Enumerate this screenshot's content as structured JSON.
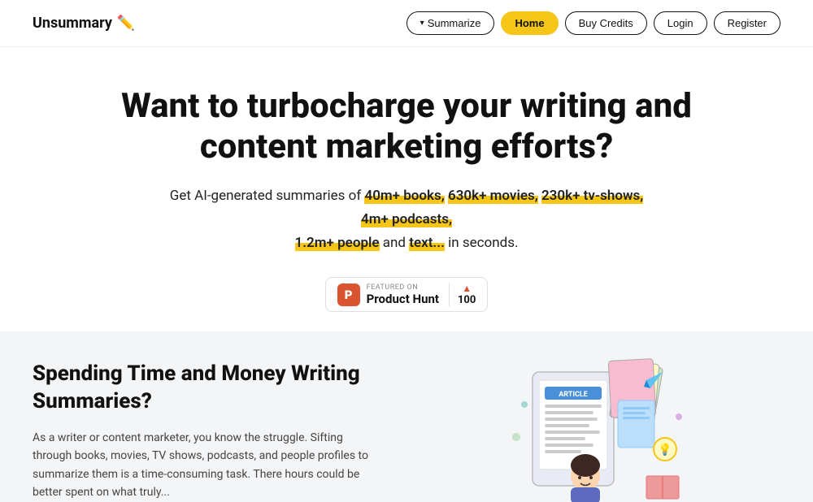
{
  "logo": {
    "text": "Unsummary",
    "icon": "✏️"
  },
  "nav": {
    "summarize_label": "Summarize",
    "home_label": "Home",
    "buy_credits_label": "Buy Credits",
    "login_label": "Login",
    "register_label": "Register"
  },
  "hero": {
    "title": "Want to turbocharge your writing and content marketing efforts?",
    "subtitle_before": "Get AI-generated summaries of ",
    "highlights": [
      "40m+ books,",
      "630k+ movies,",
      "230k+ tv-shows,",
      "4m+ podcasts,",
      "1.2m+ people"
    ],
    "subtitle_and": " and ",
    "subtitle_text": "text...",
    "subtitle_end": " in seconds."
  },
  "product_hunt": {
    "featured_label": "FEATURED ON",
    "name": "Product Hunt",
    "votes": "100",
    "logo_letter": "P"
  },
  "lower": {
    "title": "Spending Time and Money Writing Summaries?",
    "description": "As a writer or content marketer, you know the struggle. Sifting through books, movies, TV shows, podcasts, and people profiles to summarize them is a time-consuming task. There hours could be better spent on what truly..."
  }
}
